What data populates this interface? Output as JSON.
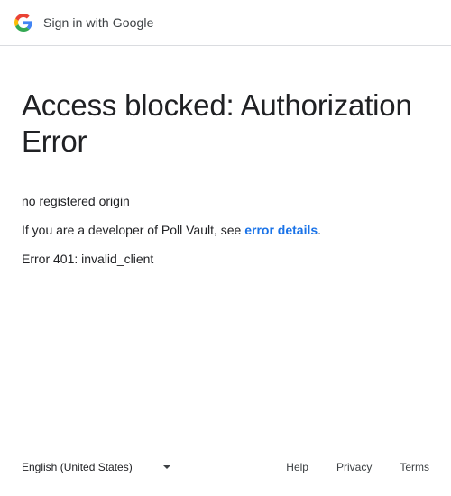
{
  "header": {
    "logo_icon": "google-g-logo",
    "title": "Sign in with Google"
  },
  "main": {
    "title": "Access blocked: Authorization Error",
    "message_1": "no registered origin",
    "message_2_prefix": "If you are a developer of Poll Vault, see ",
    "message_2_link": "error details",
    "message_2_suffix": ".",
    "message_3": "Error 401: invalid_client"
  },
  "footer": {
    "language": "English (United States)",
    "language_icon": "caret-down-icon",
    "links": [
      "Help",
      "Privacy",
      "Terms"
    ]
  },
  "colors": {
    "link": "#1a73e8",
    "text": "#202124",
    "divider": "#dadce0",
    "google_blue": "#4285F4",
    "google_red": "#EA4335",
    "google_yellow": "#FBBC05",
    "google_green": "#34A853"
  }
}
